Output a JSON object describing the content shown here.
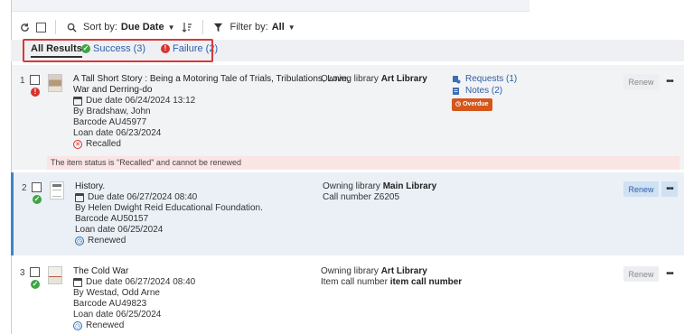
{
  "toolbar": {
    "sort_label": "Sort by:",
    "sort_value": "Due Date",
    "filter_label": "Filter by:",
    "filter_value": "All"
  },
  "tabs": [
    {
      "label": "All Results"
    },
    {
      "label": "Success (3)"
    },
    {
      "label": "Failure (2)"
    }
  ],
  "rows": [
    {
      "index": "1",
      "title_line1": "A Tall Short Story : Being a Motoring Tale of Trials, Tribulations, Love,",
      "title_line2": "War and Derring-do",
      "due_date": "Due date 06/24/2024 13:12",
      "author": "By Bradshaw, John",
      "barcode": "Barcode AU45977",
      "loan_date": "Loan date 06/23/2024",
      "status_text": "Recalled",
      "owning_label": "Owning library",
      "owning_value": "Art Library",
      "requests": "Requests (1)",
      "notes": "Notes (2)",
      "badge": "Overdue",
      "renew": "Renew",
      "message": "The item status is \"Recalled\" and cannot be renewed"
    },
    {
      "index": "2",
      "title_line1": "History.",
      "due_date": "Due date 06/27/2024 08:40",
      "author": "By Helen Dwight Reid Educational Foundation.",
      "barcode": "Barcode AU50157",
      "loan_date": "Loan date 06/25/2024",
      "status_text": "Renewed",
      "owning_label": "Owning library",
      "owning_value": "Main Library",
      "call_number": "Call number Z6205",
      "renew": "Renew"
    },
    {
      "index": "3",
      "title_line1": "The Cold War",
      "due_date": "Due date 06/27/2024 08:40",
      "author": "By Westad, Odd Arne",
      "barcode": "Barcode AU49823",
      "loan_date": "Loan date 06/25/2024",
      "status_text": "Renewed",
      "owning_label": "Owning library",
      "owning_value": "Art Library",
      "call_label": "Item call number",
      "call_value": "item call number",
      "renew": "Renew"
    }
  ],
  "colors": {
    "success": "#3ca544",
    "failure": "#d8322c",
    "link": "#2c5ea8",
    "overdue": "#d4571b",
    "highlight_box": "#d9383a"
  }
}
